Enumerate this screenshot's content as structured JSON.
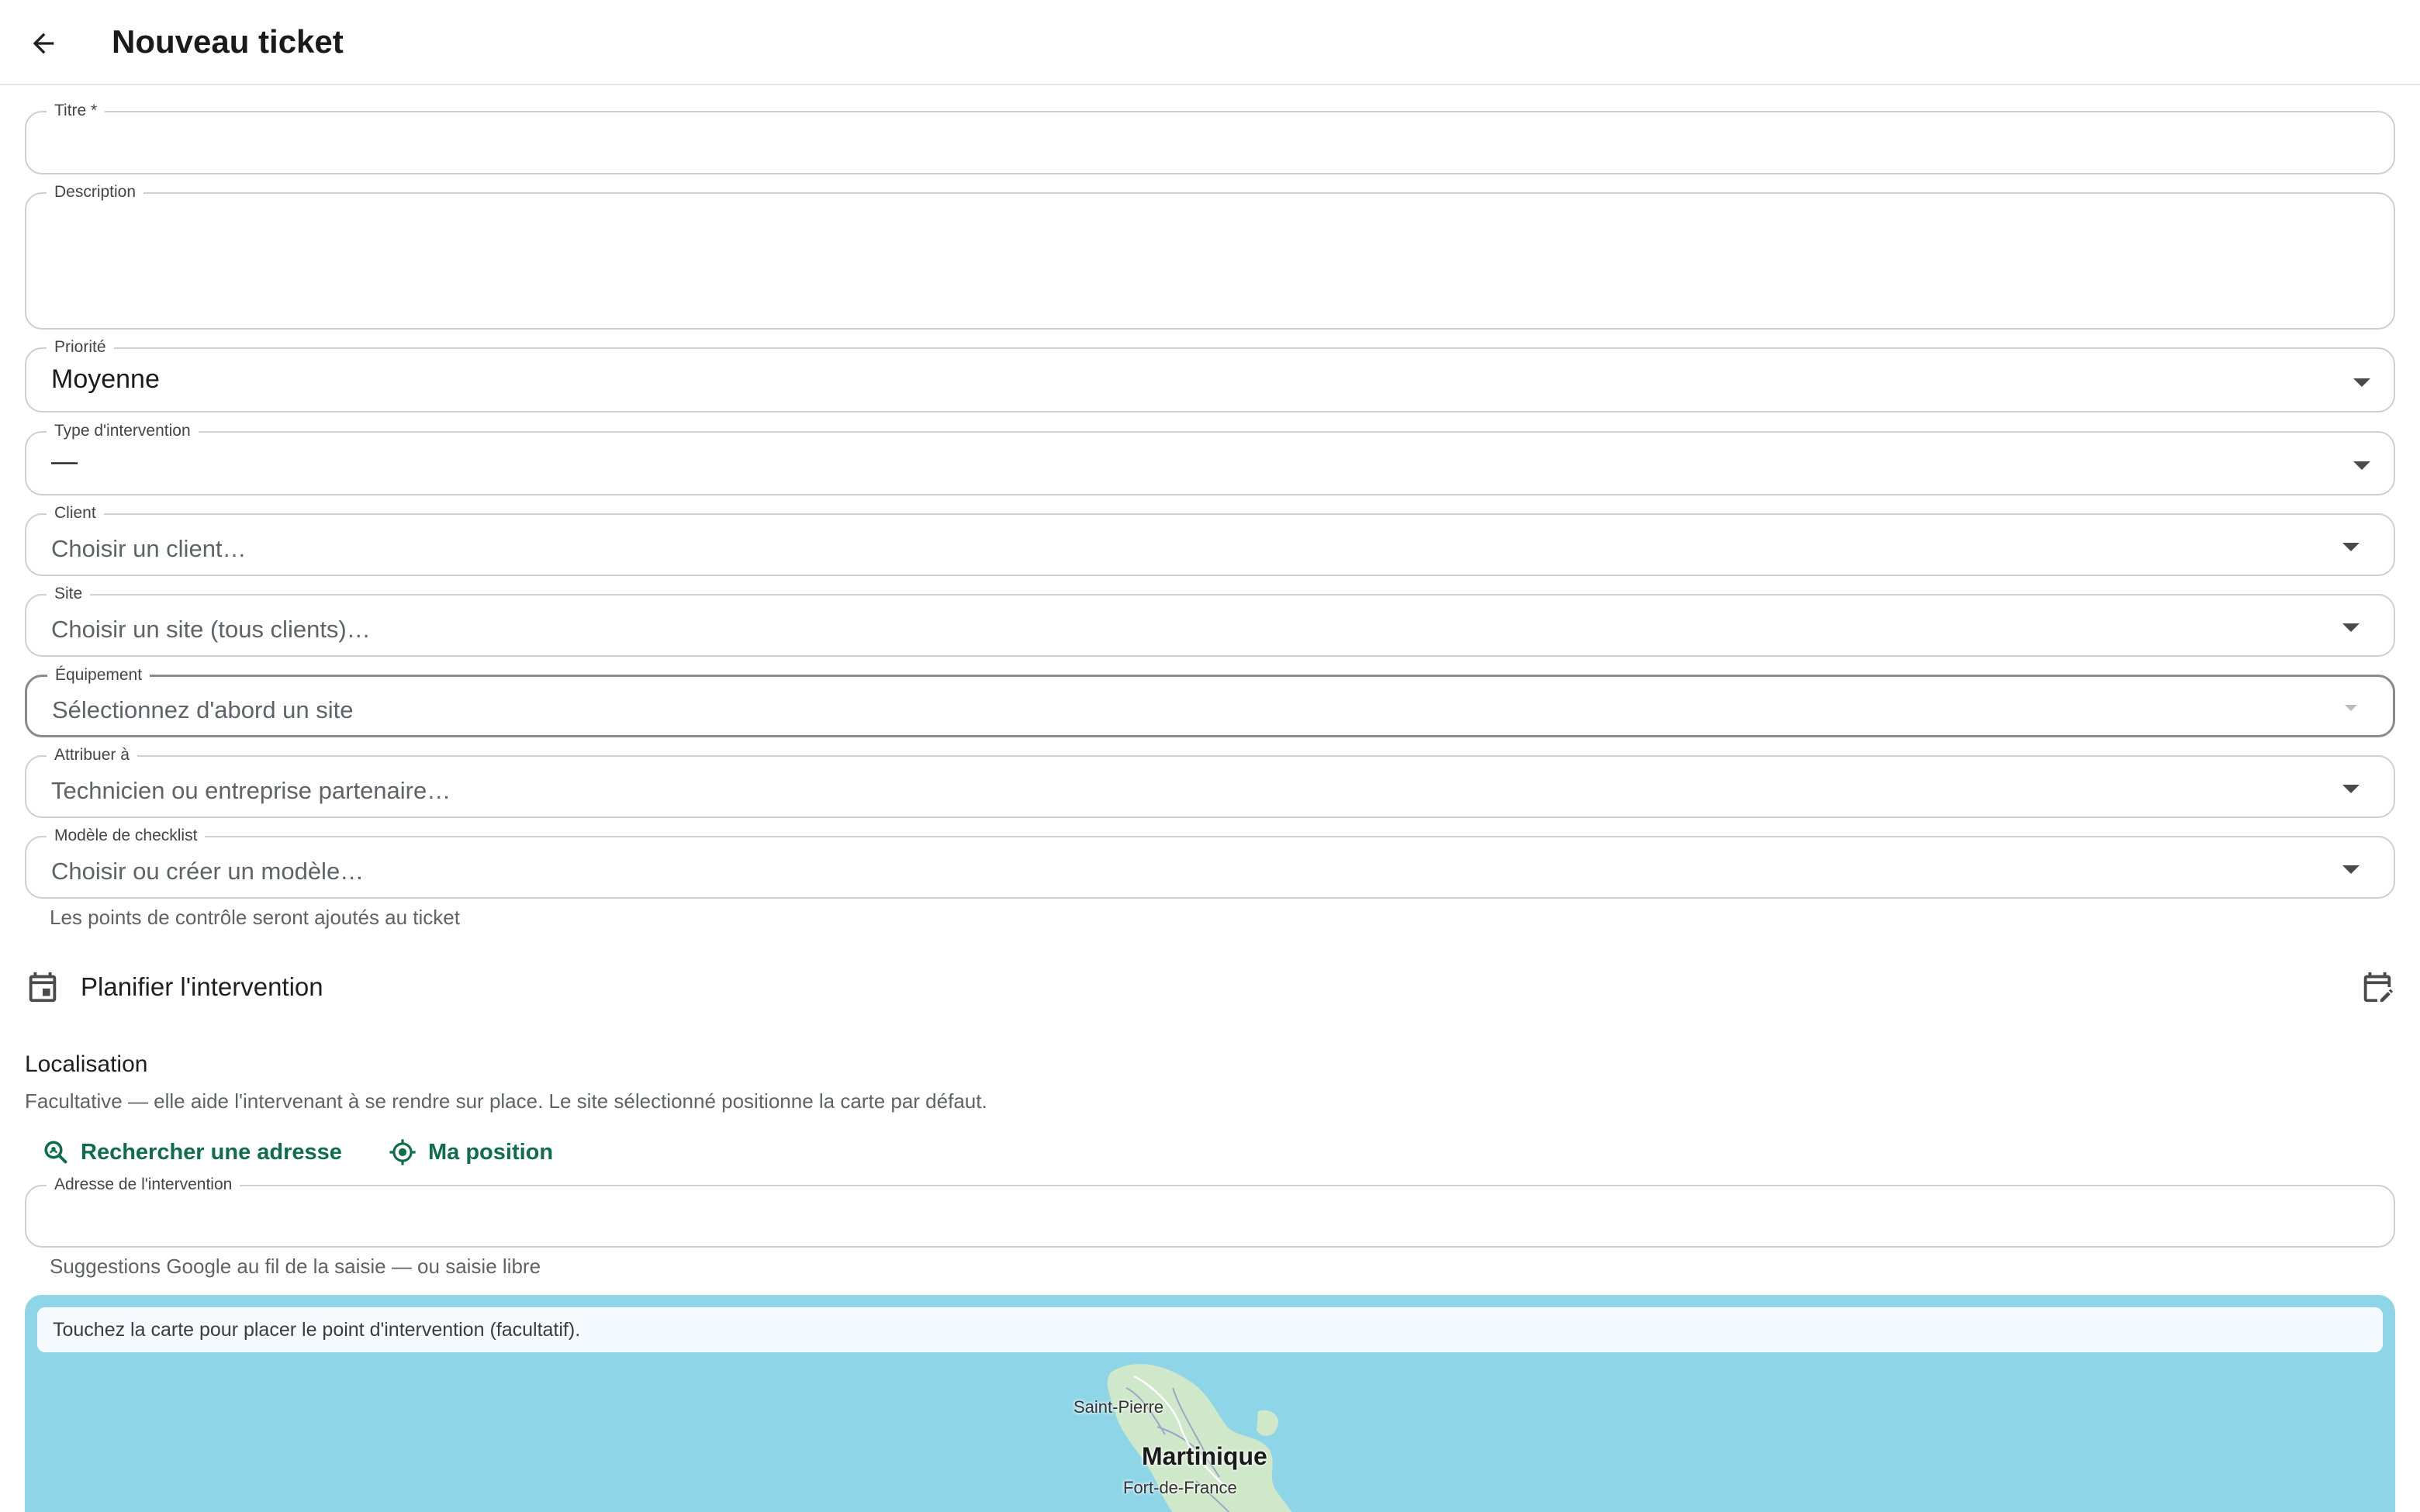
{
  "header": {
    "back_icon": "arrow-left-icon",
    "title": "Nouveau ticket"
  },
  "form": {
    "title_field": {
      "label": "Titre *",
      "value": ""
    },
    "description_field": {
      "label": "Description",
      "value": ""
    },
    "priority_field": {
      "label": "Priorité",
      "value": "Moyenne"
    },
    "intervention_type_field": {
      "label": "Type d'intervention",
      "value": "—"
    },
    "client_field": {
      "label": "Client",
      "placeholder": "Choisir un client…"
    },
    "site_field": {
      "label": "Site",
      "placeholder": "Choisir un site (tous clients)…"
    },
    "equipment_field": {
      "label": "Équipement",
      "placeholder": "Sélectionnez d'abord un site"
    },
    "assign_field": {
      "label": "Attribuer à",
      "placeholder": "Technicien ou entreprise partenaire…"
    },
    "checklist_field": {
      "label": "Modèle de checklist",
      "placeholder": "Choisir ou créer un modèle…",
      "helper": "Les points de contrôle seront ajoutés au ticket"
    }
  },
  "schedule": {
    "icon": "calendar-icon",
    "label": "Planifier l'intervention",
    "edit_icon": "calendar-edit-icon"
  },
  "location": {
    "title": "Localisation",
    "description": "Facultative — elle aide l'intervenant à se rendre sur place. Le site sélectionné positionne la carte par défaut.",
    "search_button": {
      "icon": "search-location-icon",
      "label": "Rechercher une adresse"
    },
    "my_position_button": {
      "icon": "my-location-icon",
      "label": "Ma position"
    },
    "address_field": {
      "label": "Adresse de l'intervention",
      "value": "",
      "helper": "Suggestions Google au fil de la saisie — ou saisie libre"
    }
  },
  "map": {
    "banner": "Touchez la carte pour placer le point d'intervention (facultatif).",
    "places": [
      "Saint-Pierre",
      "Martinique",
      "Fort-de-France"
    ]
  },
  "colors": {
    "accent": "#0f6e4a",
    "map_water": "#8ed5e8",
    "map_land": "#cfe8c9"
  }
}
